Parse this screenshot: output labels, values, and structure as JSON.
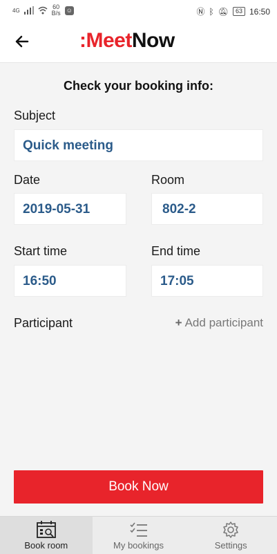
{
  "status_bar": {
    "network": "4G",
    "speed": "60",
    "speed_unit": "B/s",
    "battery": "63",
    "time": "16:50"
  },
  "app": {
    "logo_prefix": ":Meet",
    "logo_suffix": "Now",
    "colors": {
      "brand_red": "#e8242b",
      "value_blue": "#2b5b8a"
    }
  },
  "page": {
    "heading": "Check your booking info:"
  },
  "form": {
    "subject_label": "Subject",
    "subject_value": "Quick meeting",
    "date_label": "Date",
    "date_value": "2019-05-31",
    "room_label": "Room",
    "room_value": "802-2",
    "start_label": "Start time",
    "start_value": "16:50",
    "end_label": "End time",
    "end_value": "17:05",
    "participant_label": "Participant",
    "add_participant_label": "Add participant"
  },
  "actions": {
    "book_now": "Book Now"
  },
  "bottom_nav": {
    "items": [
      {
        "label": "Book room",
        "icon": "calendar-search-icon",
        "active": true
      },
      {
        "label": "My bookings",
        "icon": "checklist-icon",
        "active": false
      },
      {
        "label": "Settings",
        "icon": "gear-icon",
        "active": false
      }
    ]
  }
}
